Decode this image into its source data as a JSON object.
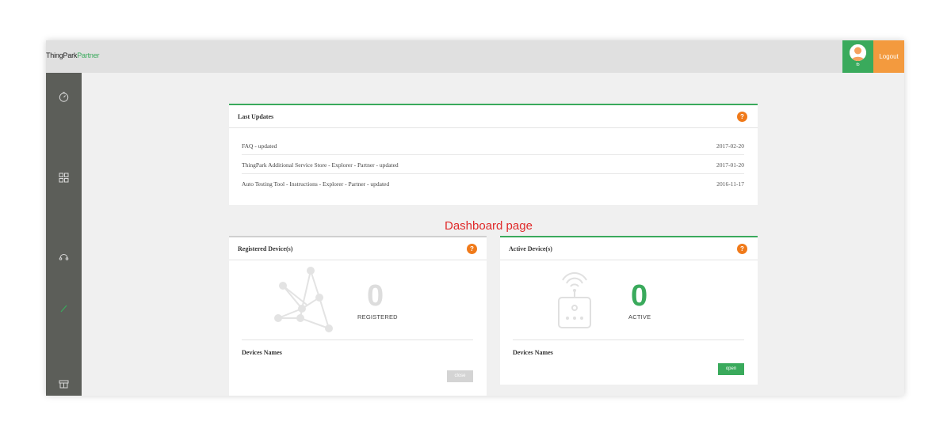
{
  "app": {
    "brand": "ThingPark",
    "brand_suffix": "Partner"
  },
  "user": {
    "initials": "tb"
  },
  "header": {
    "logout_label": "Logout"
  },
  "sidebar": {
    "items": [
      {
        "icon": "dashboard-gauge-icon"
      },
      {
        "icon": "grid-icon"
      },
      {
        "icon": "support-headset-icon"
      },
      {
        "icon": "pen-icon"
      },
      {
        "icon": "store-icon"
      }
    ]
  },
  "last_updates": {
    "title": "Last Updates",
    "help": "?",
    "items": [
      {
        "text": "FAQ - updated",
        "date": "2017-02-20"
      },
      {
        "text": "ThingPark Additional Service Store - Explorer - Partner - updated",
        "date": "2017-01-20"
      },
      {
        "text": "Auto Testing Tool - Instructions - Explorer - Partner - updated",
        "date": "2016-11-17"
      }
    ]
  },
  "caption": "Dashboard page",
  "registered": {
    "title": "Registered Device(s)",
    "help": "?",
    "count": "0",
    "count_label": "REGISTERED",
    "names_label": "Devices Names",
    "button_label": "close"
  },
  "active": {
    "title": "Active Device(s)",
    "help": "?",
    "count": "0",
    "count_label": "ACTIVE",
    "names_label": "Devices Names",
    "button_label": "open"
  },
  "colors": {
    "accent_green": "#3aaa5c",
    "logout_orange": "#f39a3e",
    "help_orange": "#f07a1a",
    "sidebar": "#5c5e59",
    "caption_red": "#e02a2a"
  }
}
